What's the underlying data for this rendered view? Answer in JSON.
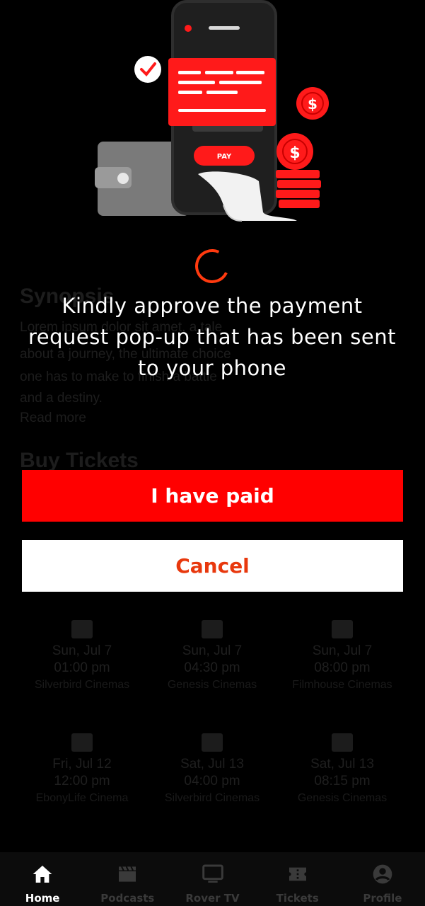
{
  "background": {
    "section_heading_1": "Synopsis",
    "synopsis_lines": [
      "Lorem ipsum dolor sit amet, a tale",
      "about a journey, the ultimate choice",
      "one has to make to finish a battle",
      "and a destiny.",
      "Read more"
    ],
    "section_heading_2": "Buy Tickets",
    "showtimes": [
      {
        "date": "Sun, Jul 7",
        "time": "01:00 pm",
        "venue": "Silverbird Cinemas"
      },
      {
        "date": "Sun, Jul 7",
        "time": "04:30 pm",
        "venue": "Genesis Cinemas"
      },
      {
        "date": "Sun, Jul 7",
        "time": "08:00 pm",
        "venue": "Filmhouse Cinemas"
      },
      {
        "date": "Fri, Jul 12",
        "time": "12:00 pm",
        "venue": "EbonyLife Cinema"
      },
      {
        "date": "Sat, Jul 13",
        "time": "04:00 pm",
        "venue": "Silverbird Cinemas"
      },
      {
        "date": "Sat, Jul 13",
        "time": "08:15 pm",
        "venue": "Genesis Cinemas"
      }
    ]
  },
  "illustration": {
    "pay_label": "PAY"
  },
  "dialog": {
    "message": "Kindly approve the payment request pop-up that has been sent to your phone",
    "paid_button": "I have paid",
    "cancel_button": "Cancel"
  },
  "nav": [
    {
      "label": "Home",
      "icon": "home-icon",
      "active": true
    },
    {
      "label": "Podcasts",
      "icon": "clapperboard-icon",
      "active": false
    },
    {
      "label": "Rover TV",
      "icon": "tv-icon",
      "active": false
    },
    {
      "label": "Tickets",
      "icon": "ticket-icon",
      "active": false
    },
    {
      "label": "Profile",
      "icon": "profile-icon",
      "active": false
    }
  ],
  "colors": {
    "accent_red": "#ff0000",
    "cancel_text": "#e8380d",
    "spinner": "#ff3a0f"
  }
}
